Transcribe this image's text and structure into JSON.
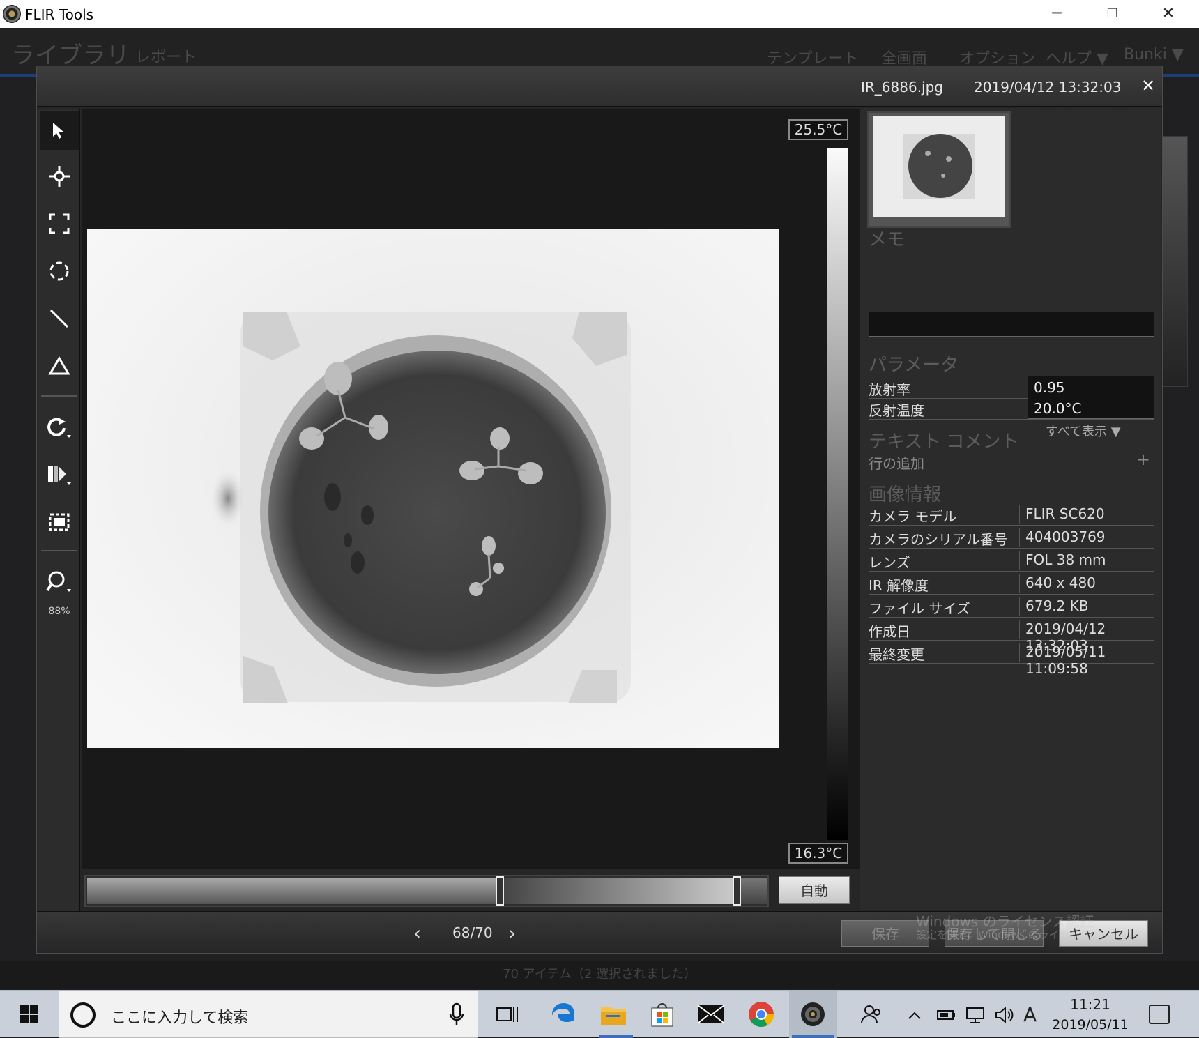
{
  "window": {
    "title": "FLIR Tools",
    "minimize": "─",
    "restore": "❐",
    "close": "✕"
  },
  "background_app": {
    "tabs": [
      "ライブラリ",
      "レポート"
    ],
    "menu": [
      "テンプレート",
      "全画面",
      "オプション",
      "ヘルプ ▼",
      "Bunki ▼"
    ],
    "status": "70 アイテム（2 選択されました）"
  },
  "viewer": {
    "filename": "IR_6886.jpg",
    "datetime": "2019/04/12 13:32:03",
    "close": "✕",
    "zoom": "88%",
    "scale_max": "25.5°C",
    "scale_min": "16.3°C",
    "auto_button": "自動"
  },
  "panel": {
    "memo_title": "メモ",
    "params_title": "パラメータ",
    "params": [
      {
        "label": "放射率",
        "value": "0.95"
      },
      {
        "label": "反射温度",
        "value": "20.0°C"
      }
    ],
    "show_all": "すべて表示 ▼",
    "text_comment_title": "テキスト コメント",
    "add_row": "行の追加",
    "add_plus": "+",
    "image_info_title": "画像情報",
    "image_info": [
      {
        "label": "カメラ モデル",
        "value": "FLIR SC620"
      },
      {
        "label": "カメラのシリアル番号",
        "value": "404003769"
      },
      {
        "label": "レンズ",
        "value": "FOL 38 mm"
      },
      {
        "label": "IR 解像度",
        "value": "640 x 480"
      },
      {
        "label": "ファイル サイズ",
        "value": "679.2 KB"
      },
      {
        "label": "作成日",
        "value": "2019/04/12 13:32:03"
      },
      {
        "label": "最終変更",
        "value": "2019/05/11 11:09:58"
      }
    ]
  },
  "footer": {
    "prev": "‹",
    "next": "›",
    "counter": "68/70",
    "save": "保存",
    "save_close": "保存して閉じる",
    "cancel": "キャンセル"
  },
  "watermark": {
    "line1": "Windows のライセンス認証",
    "line2": "設定を開き、Windows のライセンス"
  },
  "taskbar": {
    "search_placeholder": "ここに入力して検索",
    "ime": "A",
    "time": "11:21",
    "date": "2019/05/11"
  },
  "colors": {
    "accent": "#3c6fb9",
    "modal_bg": "#262626",
    "taskbar": "#c9d0d9"
  }
}
